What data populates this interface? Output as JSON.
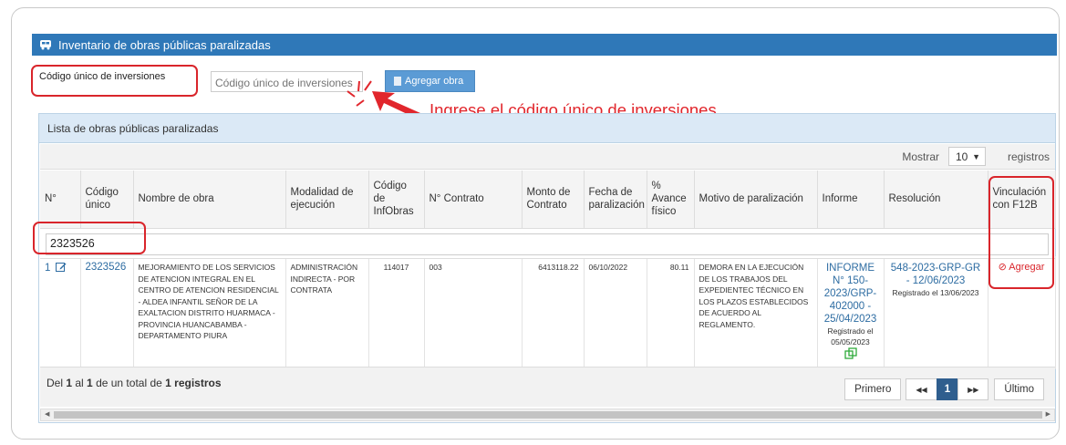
{
  "panel": {
    "title": "Inventario de obras públicas paralizadas"
  },
  "form": {
    "code_label": "Código único de inversiones",
    "code_placeholder": "Código único de inversiones",
    "add_button": "Agregar obra"
  },
  "annotation": {
    "text": "Ingrese el código único de inversiones"
  },
  "list": {
    "title": "Lista de obras públicas paralizadas",
    "show_label": "Mostrar",
    "page_size": "10",
    "records_label": "registros",
    "columns": [
      "N°",
      "Código único",
      "Nombre de obra",
      "Modalidad de ejecución",
      "Código de InfObras",
      "N° Contrato",
      "Monto de Contrato",
      "Fecha de paralización",
      "% Avance físico",
      "Motivo de paralización",
      "Informe",
      "Resolución",
      "Vinculación con F12B"
    ],
    "filter_value": "2323526",
    "rows": [
      {
        "n": "1",
        "codigo": "2323526",
        "nombre": "MEJORAMIENTO DE LOS SERVICIOS DE ATENCION INTEGRAL EN EL CENTRO DE ATENCION RESIDENCIAL - ALDEA INFANTIL SEÑOR DE LA EXALTACION DISTRITO HUARMACA - PROVINCIA HUANCABAMBA - DEPARTAMENTO PIURA",
        "modalidad": "ADMINISTRACIÓN INDIRECTA - POR CONTRATA",
        "infobras": "114017",
        "contrato": "003",
        "monto": "6413118.22",
        "fecha": "06/10/2022",
        "avance": "80.11",
        "motivo": "DEMORA EN LA EJECUCIÓN DE LOS TRABAJOS DEL EXPEDIENTEC TÉCNICO EN LOS PLAZOS ESTABLECIDOS DE ACUERDO AL REGLAMENTO.",
        "informe": "INFORME N° 150-2023/GRP-402000 - 25/04/2023",
        "informe_registrado": "Registrado el 05/05/2023",
        "resolucion": "548-2023-GRP-GR - 12/06/2023",
        "resolucion_registrado": "Registrado el 13/06/2023",
        "vinculacion": "Agregar"
      }
    ],
    "footer": {
      "prefix": "Del ",
      "from": "1",
      "mid1": " al ",
      "to": "1",
      "mid2": " de un total de ",
      "total": "1 registros"
    },
    "pager": {
      "first": "Primero",
      "prev": "◀◀",
      "current": "1",
      "next": "▶▶",
      "last": "Último"
    }
  },
  "colors": {
    "header_blue": "#2f78b8",
    "highlight_red": "#d9252b",
    "link_blue": "#2d6ca2"
  }
}
